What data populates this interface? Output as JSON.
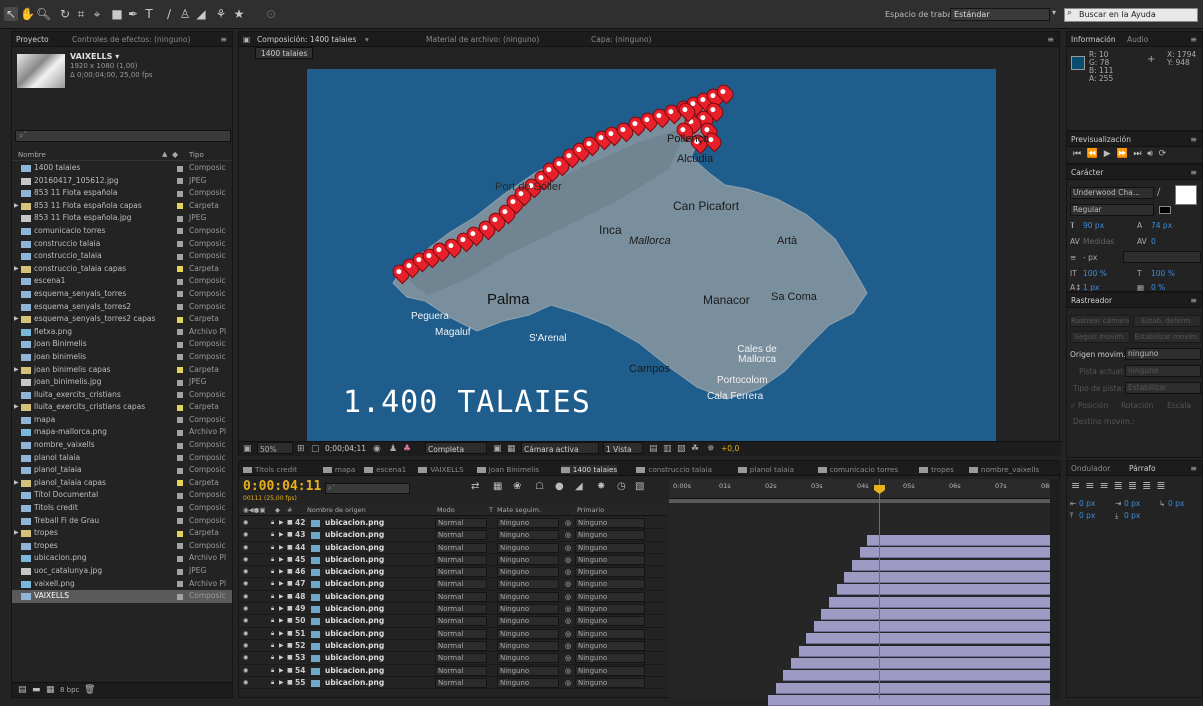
{
  "toolbar": {
    "workspace_label": "Espacio de trabajo:",
    "workspace_value": "Estándar",
    "help_search_placeholder": "Buscar en la Ayuda"
  },
  "project": {
    "tab_project": "Proyecto",
    "tab_effects": "Controles de efectos: (ninguno)",
    "selected_name": "VAIXELLS ▾",
    "selected_meta1": "1920 x 1080 (1,00)",
    "selected_meta2": "Δ 0;00;04;00, 25,00 fps",
    "col_name": "Nombre",
    "col_type": "Tipo",
    "items": [
      {
        "name": "1400 talaies",
        "type": "Composic",
        "kind": "comp",
        "tag": "#a3a3a3"
      },
      {
        "name": "20160417_105612.jpg",
        "type": "JPEG",
        "kind": "img",
        "tag": "#a3a3a3"
      },
      {
        "name": "853 11 Flota española",
        "type": "Composic",
        "kind": "comp",
        "tag": "#a3a3a3"
      },
      {
        "name": "853 11 Flota española capas",
        "type": "Carpeta",
        "kind": "folder",
        "tag": "#e5d35a"
      },
      {
        "name": "853 11 Flota española.jpg",
        "type": "JPEG",
        "kind": "img",
        "tag": "#a3a3a3"
      },
      {
        "name": "comunicacio torres",
        "type": "Composic",
        "kind": "comp",
        "tag": "#a3a3a3"
      },
      {
        "name": "construccio talaia",
        "type": "Composic",
        "kind": "comp",
        "tag": "#a3a3a3"
      },
      {
        "name": "construccio_talaia",
        "type": "Composic",
        "kind": "comp",
        "tag": "#a3a3a3"
      },
      {
        "name": "construccio_talaia capas",
        "type": "Carpeta",
        "kind": "folder",
        "tag": "#e5d35a"
      },
      {
        "name": "escena1",
        "type": "Composic",
        "kind": "comp",
        "tag": "#a3a3a3"
      },
      {
        "name": "esquema_senyals_torres",
        "type": "Composic",
        "kind": "comp",
        "tag": "#a3a3a3"
      },
      {
        "name": "esquema_senyals_torres2",
        "type": "Composic",
        "kind": "comp",
        "tag": "#a3a3a3"
      },
      {
        "name": "esquema_senyals_torres2 capas",
        "type": "Carpeta",
        "kind": "folder",
        "tag": "#e5d35a"
      },
      {
        "name": "fletxa.png",
        "type": "Archivo Pl",
        "kind": "png",
        "tag": "#a3a3a3"
      },
      {
        "name": "Joan Binimelis",
        "type": "Composic",
        "kind": "comp",
        "tag": "#a3a3a3"
      },
      {
        "name": "joan binimelis",
        "type": "Composic",
        "kind": "comp",
        "tag": "#a3a3a3"
      },
      {
        "name": "joan binimelis capas",
        "type": "Carpeta",
        "kind": "folder",
        "tag": "#e5d35a"
      },
      {
        "name": "joan_binimelis.jpg",
        "type": "JPEG",
        "kind": "img",
        "tag": "#a3a3a3"
      },
      {
        "name": "lluita_exercits_cristians",
        "type": "Composic",
        "kind": "comp",
        "tag": "#a3a3a3"
      },
      {
        "name": "lluita_exercits_cristians capas",
        "type": "Carpeta",
        "kind": "folder",
        "tag": "#e5d35a"
      },
      {
        "name": "mapa",
        "type": "Composic",
        "kind": "comp",
        "tag": "#a3a3a3"
      },
      {
        "name": "mapa-mallorca.png",
        "type": "Archivo Pl",
        "kind": "png",
        "tag": "#a3a3a3"
      },
      {
        "name": "nombre_vaixells",
        "type": "Composic",
        "kind": "comp",
        "tag": "#a3a3a3"
      },
      {
        "name": "planol talaia",
        "type": "Composic",
        "kind": "comp",
        "tag": "#a3a3a3"
      },
      {
        "name": "planol_talaia",
        "type": "Composic",
        "kind": "comp",
        "tag": "#a3a3a3"
      },
      {
        "name": "planol_talaia capas",
        "type": "Carpeta",
        "kind": "folder",
        "tag": "#e5d35a"
      },
      {
        "name": "Títol Documental",
        "type": "Composic",
        "kind": "comp",
        "tag": "#a3a3a3"
      },
      {
        "name": "Titols credit",
        "type": "Composic",
        "kind": "comp",
        "tag": "#a3a3a3"
      },
      {
        "name": "Treball Fi de Grau",
        "type": "Composic",
        "kind": "comp",
        "tag": "#a3a3a3"
      },
      {
        "name": "tropes",
        "type": "Carpeta",
        "kind": "folder",
        "tag": "#e5d35a"
      },
      {
        "name": "tropes",
        "type": "Composic",
        "kind": "comp",
        "tag": "#a3a3a3"
      },
      {
        "name": "ubicacion.png",
        "type": "Archivo Pl",
        "kind": "png",
        "tag": "#a3a3a3"
      },
      {
        "name": "uoc_catalunya.jpg",
        "type": "JPEG",
        "kind": "img",
        "tag": "#a3a3a3"
      },
      {
        "name": "vaixell.png",
        "type": "Archivo Pl",
        "kind": "png",
        "tag": "#a3a3a3"
      },
      {
        "name": "VAIXELLS",
        "type": "Composic",
        "kind": "comp",
        "tag": "#a3a3a3",
        "selected": true
      }
    ],
    "footer_bpc": "8 bpc"
  },
  "composition": {
    "tab_comp": "Composición: 1400 talaies",
    "tab_footage": "Material de archivo: (ninguno)",
    "tab_layer": "Capa: (ninguno)",
    "sub_tab": "1400 talaies",
    "map_labels": {
      "pollenca": "Pollença",
      "alcudia": "Alcúdia",
      "soller": "Port de Sóller",
      "capicafort": "Can Picafort",
      "inca": "Inca",
      "mallorca": "Mallorca",
      "arta": "Artà",
      "palma": "Palma",
      "manacor": "Manacor",
      "sacoma": "Sa Coma",
      "peguera": "Peguera",
      "magaluf": "Magaluf",
      "sarenal": "S'Arenal",
      "calesde": "Cales de Mallorca",
      "campos": "Campos",
      "portocolom": "Portocolom",
      "calaferrera": "Cala Ferrera"
    },
    "overlay_title": "1.400 TALAIES",
    "footer": {
      "zoom": "50%",
      "time": "0;00;04;11",
      "resolution": "Completa",
      "camera": "Cámara activa",
      "view": "1 Vista",
      "exposure": "+0,0"
    }
  },
  "timeline": {
    "tabs": [
      {
        "label": "Titols credit",
        "color": "#9a9a9a"
      },
      {
        "label": "mapa",
        "color": "#9a9a9a"
      },
      {
        "label": "escena1",
        "color": "#9a9a9a"
      },
      {
        "label": "VAIXELLS",
        "color": "#9a9a9a"
      },
      {
        "label": "Joan Binimelis",
        "color": "#9a9a9a"
      },
      {
        "label": "1400 talaies",
        "color": "#9a9a9a",
        "active": true
      },
      {
        "label": "construccio talaia",
        "color": "#9a9a9a"
      },
      {
        "label": "planol talaia",
        "color": "#9a9a9a"
      },
      {
        "label": "comunicacio torres",
        "color": "#9a9a9a"
      },
      {
        "label": "tropes",
        "color": "#9a9a9a"
      },
      {
        "label": "nombre_vaixells",
        "color": "#9a9a9a"
      }
    ],
    "timecode": "0:00:04:11",
    "timecode_sub": "00111 (25,00 fps)",
    "col_source": "Nombre de origen",
    "col_mode": "Modo",
    "col_t": "T",
    "col_matte": "Mate seguim.",
    "col_parent": "Primario",
    "ruler_labels": [
      "0:00s",
      "01s",
      "02s",
      "03s",
      "04s",
      "05s",
      "06s",
      "07s",
      "08s"
    ],
    "layers": [
      {
        "num": "42",
        "name": "ubicacion.png",
        "mode": "Normal",
        "matte": "Ninguno",
        "parent": "Ninguno",
        "start": 0.52
      },
      {
        "num": "43",
        "name": "ubicacion.png",
        "mode": "Normal",
        "matte": "Ninguno",
        "parent": "Ninguno",
        "start": 0.5
      },
      {
        "num": "44",
        "name": "ubicacion.png",
        "mode": "Normal",
        "matte": "Ninguno",
        "parent": "Ninguno",
        "start": 0.48
      },
      {
        "num": "45",
        "name": "ubicacion.png",
        "mode": "Normal",
        "matte": "Ninguno",
        "parent": "Ninguno",
        "start": 0.46
      },
      {
        "num": "46",
        "name": "ubicacion.png",
        "mode": "Normal",
        "matte": "Ninguno",
        "parent": "Ninguno",
        "start": 0.44
      },
      {
        "num": "47",
        "name": "ubicacion.png",
        "mode": "Normal",
        "matte": "Ninguno",
        "parent": "Ninguno",
        "start": 0.42
      },
      {
        "num": "48",
        "name": "ubicacion.png",
        "mode": "Normal",
        "matte": "Ninguno",
        "parent": "Ninguno",
        "start": 0.4
      },
      {
        "num": "49",
        "name": "ubicacion.png",
        "mode": "Normal",
        "matte": "Ninguno",
        "parent": "Ninguno",
        "start": 0.38
      },
      {
        "num": "50",
        "name": "ubicacion.png",
        "mode": "Normal",
        "matte": "Ninguno",
        "parent": "Ninguno",
        "start": 0.36
      },
      {
        "num": "51",
        "name": "ubicacion.png",
        "mode": "Normal",
        "matte": "Ninguno",
        "parent": "Ninguno",
        "start": 0.34
      },
      {
        "num": "52",
        "name": "ubicacion.png",
        "mode": "Normal",
        "matte": "Ninguno",
        "parent": "Ninguno",
        "start": 0.32
      },
      {
        "num": "53",
        "name": "ubicacion.png",
        "mode": "Normal",
        "matte": "Ninguno",
        "parent": "Ninguno",
        "start": 0.3
      },
      {
        "num": "54",
        "name": "ubicacion.png",
        "mode": "Normal",
        "matte": "Ninguno",
        "parent": "Ninguno",
        "start": 0.28
      },
      {
        "num": "55",
        "name": "ubicacion.png",
        "mode": "Normal",
        "matte": "Ninguno",
        "parent": "Ninguno",
        "start": 0.26
      }
    ]
  },
  "info": {
    "tab_info": "Información",
    "tab_audio": "Audio",
    "r": "R: 10",
    "g": "G: 78",
    "b": "B: 111",
    "a": "A: 255",
    "x": "X: 1794",
    "y": "Y: 948",
    "swatch": "#0a4e6f"
  },
  "preview": {
    "tab": "Previsualización"
  },
  "character": {
    "tab": "Carácter",
    "font": "Underwood Cha...",
    "style": "Regular",
    "size": "90 px",
    "leading": "74 px",
    "kerning": "Medidas",
    "tracking": "0",
    "stroke": "- px",
    "vscale": "100 %",
    "hscale": "100 %",
    "baseline": "1 px",
    "tsume": "0 %"
  },
  "tracker": {
    "tab": "Rastreador",
    "track_camera": "Rastrear cámara",
    "warp": "Estab. deform.",
    "track_motion": "Seguir movim.",
    "stabilize": "Estabilizar movim.",
    "origin_label": "Origen movim.:",
    "origin_value": "ninguno",
    "current_label": "Pista actual:",
    "current_value": "ninguno",
    "type_label": "Tipo de pista:",
    "type_value": "Estabilizar",
    "pos": "Posición",
    "rot": "Rotación",
    "scale": "Escala",
    "target": "Destino movim.:"
  },
  "paragraph": {
    "tab_wiggler": "Ondulador",
    "tab_para": "Párrafo",
    "indent1": "0 px",
    "indent2": "0 px",
    "indent3": "0 px",
    "space1": "0 px",
    "space2": "0 px"
  }
}
